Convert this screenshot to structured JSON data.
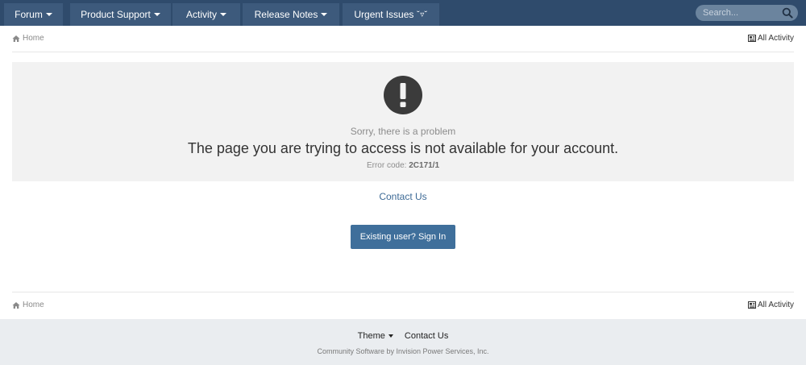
{
  "nav": {
    "tabs": [
      {
        "label": "Forum"
      },
      {
        "label": "Product Support"
      },
      {
        "label": "Activity"
      },
      {
        "label": "Release Notes"
      },
      {
        "label": "Urgent Issues",
        "glyph": "˘▿˘"
      }
    ],
    "search": {
      "placeholder": "Search...",
      "icon": "search-icon"
    }
  },
  "breadcrumb": {
    "home_label": "Home",
    "home_icon": "home-icon",
    "all_activity_label": "All Activity",
    "all_activity_icon": "activity-icon"
  },
  "error": {
    "icon": "exclamation-circle-icon",
    "subtitle": "Sorry, there is a problem",
    "message": "The page you are trying to access is not available for your account.",
    "code_label": "Error code:",
    "code": "2C171/1"
  },
  "actions": {
    "contact_label": "Contact Us",
    "signin_label": "Existing user? Sign In"
  },
  "footer": {
    "theme_label": "Theme",
    "contact_label": "Contact Us",
    "credit": "Community Software by Invision Power Services, Inc."
  },
  "colors": {
    "nav_background": "#2f4b6c",
    "nav_tab": "#3d5a7c",
    "primary_button": "#3f6f9b",
    "link": "#3d6a96",
    "panel": "#f2f2f2",
    "footer": "#eaedf0"
  }
}
